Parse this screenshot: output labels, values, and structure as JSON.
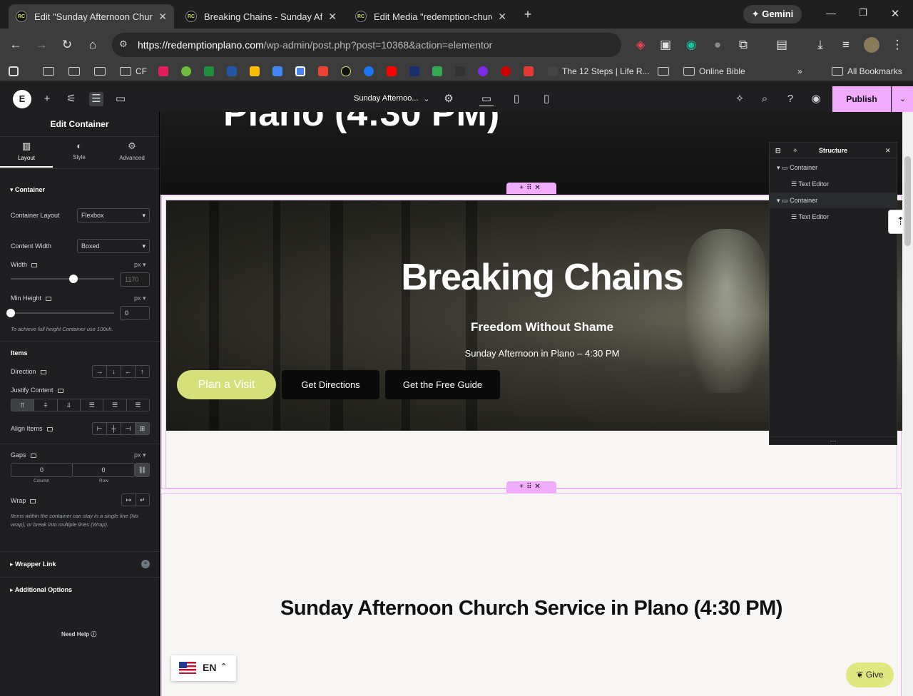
{
  "browser": {
    "tabs": [
      {
        "title": "Edit \"Sunday Afternoon Church",
        "active": true
      },
      {
        "title": "Breaking Chains - Sunday Aftern",
        "active": false
      },
      {
        "title": "Edit Media \"redemption-church",
        "active": false
      }
    ],
    "gemini_label": "Gemini",
    "url_host": "https://redemptionplano.com",
    "url_path": "/wp-admin/post.php?post=10368&action=elementor",
    "bookmarks": {
      "cf": "CF",
      "steps": "The 12 Steps | Life R...",
      "bible": "Online Bible",
      "all": "All Bookmarks"
    }
  },
  "elementor": {
    "page_name": "Sunday Afternoo...",
    "publish_label": "Publish",
    "panel": {
      "title": "Edit Container",
      "tabs": [
        "Layout",
        "Style",
        "Advanced"
      ],
      "section_container": "Container",
      "container_layout_label": "Container Layout",
      "container_layout_value": "Flexbox",
      "content_width_label": "Content Width",
      "content_width_value": "Boxed",
      "width_label": "Width",
      "width_unit": "px",
      "width_value": "1170",
      "min_height_label": "Min Height",
      "min_height_unit": "px",
      "min_height_value": "0",
      "min_height_hint": "To achieve full height Container use 100vh.",
      "items_label": "Items",
      "direction_label": "Direction",
      "justify_label": "Justify Content",
      "align_label": "Align Items",
      "gaps_label": "Gaps",
      "gaps_unit": "px",
      "gap_column_value": "0",
      "gap_row_value": "0",
      "gap_column_label": "Column",
      "gap_row_label": "Row",
      "wrap_label": "Wrap",
      "wrap_hint": "Items within the container can stay in a single line (No wrap), or break into multiple lines (Wrap).",
      "wrapper_link": "Wrapper Link",
      "additional_options": "Additional Options",
      "need_help": "Need Help"
    },
    "structure": {
      "title": "Structure",
      "items": [
        {
          "label": "Container",
          "level": 0
        },
        {
          "label": "Text Editor",
          "level": 1
        },
        {
          "label": "Container",
          "level": 0
        },
        {
          "label": "Text Editor",
          "level": 1
        }
      ]
    }
  },
  "canvas": {
    "prev_title": "Plano (4:30 PM)",
    "hero_title": "Breaking Chains",
    "hero_subtitle": "Freedom Without Shame",
    "hero_time": "Sunday Afternoon in Plano – 4:30 PM",
    "btn_visit": "Plan a Visit",
    "btn_directions": "Get Directions",
    "btn_guide": "Get the Free Guide",
    "bottom_title": "Sunday Afternoon Church Service in Plano (4:30 PM)",
    "lang": "EN",
    "give": "Give"
  },
  "colors": {
    "accent": "#f0abfc",
    "cta": "#d6e07a",
    "give": "#dfe87f"
  }
}
